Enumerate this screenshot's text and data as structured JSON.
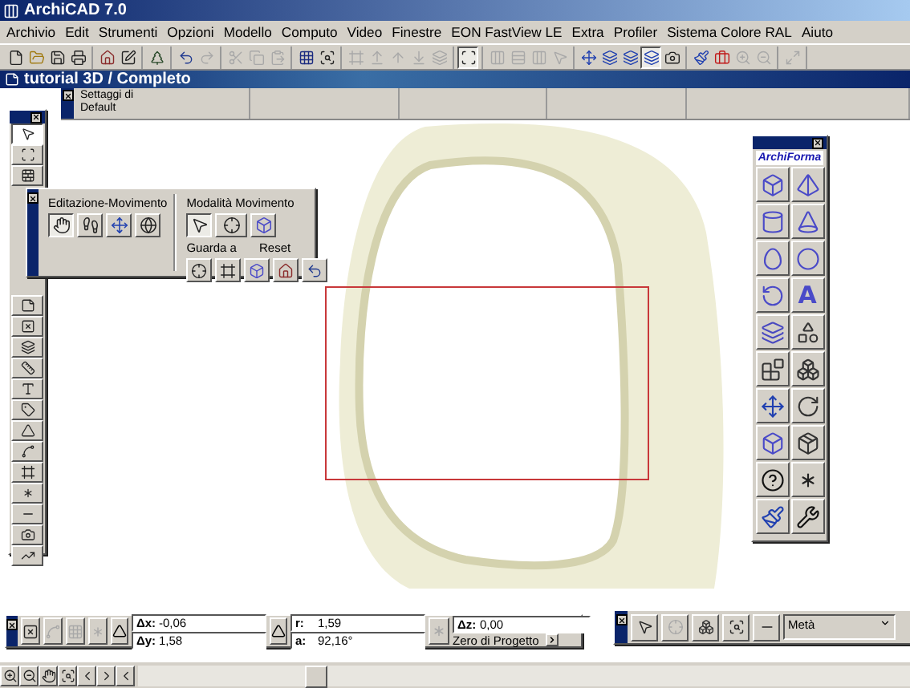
{
  "window": {
    "title": "ArchiCAD 7.0"
  },
  "menu": [
    "Archivio",
    "Edit",
    "Strumenti",
    "Opzioni",
    "Modello",
    "Computo",
    "Video",
    "Finestre",
    "EON FastView LE",
    "Extra",
    "Profiler",
    "Sistema Colore RAL",
    "Aiuto"
  ],
  "toolbar": [
    [
      {
        "kind": "new",
        "disabled": false,
        "pressed": false
      },
      {
        "kind": "open",
        "disabled": false,
        "pressed": false
      },
      {
        "kind": "save",
        "disabled": false,
        "pressed": false
      },
      {
        "kind": "print",
        "disabled": false,
        "pressed": false
      }
    ],
    [
      {
        "kind": "house",
        "disabled": false,
        "pressed": false
      },
      {
        "kind": "edit",
        "disabled": false,
        "pressed": false
      }
    ],
    [
      {
        "kind": "tree",
        "disabled": false,
        "pressed": false
      }
    ],
    [
      {
        "kind": "undo",
        "disabled": false,
        "pressed": false
      },
      {
        "kind": "redo",
        "disabled": true,
        "pressed": false
      }
    ],
    [
      {
        "kind": "cut",
        "disabled": true,
        "pressed": false
      },
      {
        "kind": "copy",
        "disabled": true,
        "pressed": false
      },
      {
        "kind": "paste",
        "disabled": true,
        "pressed": false
      }
    ],
    [
      {
        "kind": "grid",
        "disabled": false,
        "pressed": false
      },
      {
        "kind": "zoom-search",
        "disabled": false,
        "pressed": false
      }
    ],
    [
      {
        "kind": "frame",
        "disabled": true,
        "pressed": false
      },
      {
        "kind": "up-line",
        "disabled": true,
        "pressed": false
      },
      {
        "kind": "up",
        "disabled": true,
        "pressed": false
      },
      {
        "kind": "down-line",
        "disabled": true,
        "pressed": false
      },
      {
        "kind": "layers",
        "disabled": true,
        "pressed": false
      }
    ],
    [
      {
        "kind": "marquee",
        "disabled": false,
        "pressed": true
      }
    ],
    [
      {
        "kind": "columns",
        "disabled": true,
        "pressed": false
      },
      {
        "kind": "rows",
        "disabled": true,
        "pressed": false
      },
      {
        "kind": "columns",
        "disabled": true,
        "pressed": false
      },
      {
        "kind": "pointer",
        "disabled": true,
        "pressed": false
      }
    ],
    [
      {
        "kind": "move",
        "disabled": false,
        "pressed": false
      },
      {
        "kind": "stack",
        "disabled": false,
        "pressed": false
      },
      {
        "kind": "stack",
        "disabled": false,
        "pressed": false
      },
      {
        "kind": "stack",
        "disabled": false,
        "pressed": true
      },
      {
        "kind": "camera",
        "disabled": false,
        "pressed": false
      }
    ],
    [
      {
        "kind": "paint",
        "disabled": false,
        "pressed": false
      },
      {
        "kind": "case",
        "disabled": false,
        "pressed": false
      },
      {
        "kind": "zoom-in",
        "disabled": true,
        "pressed": false
      },
      {
        "kind": "zoom-out",
        "disabled": true,
        "pressed": false
      }
    ],
    [
      {
        "kind": "maximize",
        "disabled": true,
        "pressed": false
      }
    ]
  ],
  "document": {
    "title": "tutorial 3D / Completo",
    "settings": "Settaggi di Default"
  },
  "toolbox": {
    "top": [
      {
        "kind": "pointer",
        "selected": true
      },
      {
        "kind": "marquee",
        "selected": false
      },
      {
        "kind": "wall",
        "selected": false
      }
    ],
    "bottom": [
      {
        "kind": "door",
        "selected": false
      },
      {
        "kind": "window",
        "selected": false
      },
      {
        "kind": "slab",
        "selected": false
      },
      {
        "kind": "ruler",
        "selected": false
      },
      {
        "kind": "text",
        "selected": false
      },
      {
        "kind": "label",
        "selected": false
      },
      {
        "kind": "slope",
        "selected": false
      },
      {
        "kind": "polyline",
        "selected": false
      },
      {
        "kind": "frame",
        "selected": false
      },
      {
        "kind": "asterisk",
        "selected": false
      },
      {
        "kind": "line",
        "selected": false
      },
      {
        "kind": "camera",
        "selected": false
      },
      {
        "kind": "stair",
        "selected": false
      }
    ]
  },
  "navigation": {
    "edit_title": "Editazione-Movimento",
    "edit_buttons": [
      {
        "kind": "hand",
        "selected": true
      },
      {
        "kind": "walk",
        "selected": false
      },
      {
        "kind": "move",
        "selected": false
      },
      {
        "kind": "globe",
        "selected": false
      }
    ],
    "mode_title": "Modalità Movimento",
    "mode_buttons": [
      {
        "kind": "pointer",
        "selected": true
      },
      {
        "kind": "crosshair",
        "selected": false
      },
      {
        "kind": "box",
        "selected": false
      }
    ],
    "look_title": "Guarda a",
    "reset_title": "Reset",
    "look_buttons": [
      {
        "kind": "crosshair"
      },
      {
        "kind": "frame"
      },
      {
        "kind": "box"
      },
      {
        "kind": "house"
      },
      {
        "kind": "undo"
      }
    ]
  },
  "archiforma": {
    "title": "ArchiForma",
    "rows": [
      [
        {
          "kind": "box"
        },
        {
          "kind": "pyramid"
        }
      ],
      [
        {
          "kind": "cylinder"
        },
        {
          "kind": "cone"
        }
      ],
      [
        {
          "kind": "egg"
        },
        {
          "kind": "sphere"
        }
      ],
      [
        {
          "kind": "revolve"
        },
        {
          "kind": "letter",
          "glyph": "A"
        }
      ],
      [
        {
          "kind": "layers"
        },
        {
          "kind": "shapes"
        }
      ],
      [
        {
          "kind": "blocks"
        },
        {
          "kind": "boxes"
        }
      ],
      [
        {
          "kind": "move"
        },
        {
          "kind": "rotate"
        }
      ],
      [
        {
          "kind": "box"
        },
        {
          "kind": "package"
        }
      ],
      [
        {
          "kind": "help"
        },
        {
          "kind": "asterisk"
        }
      ],
      [
        {
          "kind": "paint"
        },
        {
          "kind": "wrench"
        }
      ]
    ]
  },
  "coordinates": {
    "fields": [
      {
        "label": "Δx:",
        "value": "-0,06"
      },
      {
        "label": "Δy:",
        "value": "1,58"
      },
      {
        "label": "r:",
        "value": "1,59"
      },
      {
        "label": "a:",
        "value": "92,16°"
      },
      {
        "label": "Δz:",
        "value": "0,00"
      }
    ],
    "reference": "Zero di Progetto"
  },
  "display": {
    "option": "Metà"
  },
  "status_bar": {
    "buttons": [
      {
        "kind": "zoom-in"
      },
      {
        "kind": "zoom-out"
      },
      {
        "kind": "hand"
      },
      {
        "kind": "zoom-search"
      },
      {
        "kind": "prev"
      },
      {
        "kind": "next"
      },
      {
        "kind": "left"
      }
    ]
  }
}
